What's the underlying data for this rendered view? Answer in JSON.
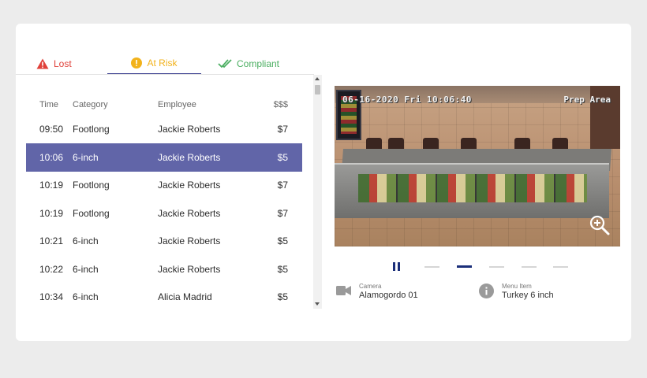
{
  "tabs": [
    {
      "label": "Lost",
      "icon": "warning-triangle-icon",
      "color": "#e0413a"
    },
    {
      "label": "At Risk",
      "icon": "exclamation-circle-icon",
      "color": "#f2b21b",
      "active": true
    },
    {
      "label": "Compliant",
      "icon": "double-check-icon",
      "color": "#4caf62"
    }
  ],
  "table": {
    "headers": {
      "time": "Time",
      "category": "Category",
      "employee": "Employee",
      "amount": "$$$"
    },
    "rows": [
      {
        "time": "09:50",
        "category": "Footlong",
        "employee": "Jackie Roberts",
        "amount": "$7"
      },
      {
        "time": "10:06",
        "category": "6-inch",
        "employee": "Jackie Roberts",
        "amount": "$5",
        "selected": true
      },
      {
        "time": "10:19",
        "category": "Footlong",
        "employee": "Jackie Roberts",
        "amount": "$7"
      },
      {
        "time": "10:19",
        "category": "Footlong",
        "employee": "Jackie Roberts",
        "amount": "$7"
      },
      {
        "time": "10:21",
        "category": "6-inch",
        "employee": "Jackie Roberts",
        "amount": "$5"
      },
      {
        "time": "10:22",
        "category": "6-inch",
        "employee": "Jackie Roberts",
        "amount": "$5"
      },
      {
        "time": "10:34",
        "category": "6-inch",
        "employee": "Alicia Madrid",
        "amount": "$5"
      }
    ]
  },
  "video": {
    "timestamp": "06-16-2020 Fri 10:06:40",
    "camera_label": "Prep Area",
    "zoom_icon": "zoom-in-icon"
  },
  "player": {
    "pause_icon": "pause-icon",
    "segments": 6,
    "active_segment": 2
  },
  "info": {
    "camera": {
      "caption": "Camera",
      "value": "Alamogordo 01",
      "icon": "video-camera-icon"
    },
    "menu_item": {
      "caption": "Menu Item",
      "value": "Turkey 6 inch",
      "icon": "info-icon"
    }
  },
  "colors": {
    "accent": "#1b2f7a",
    "selected_row": "#6165a8",
    "lost": "#e0413a",
    "at_risk": "#f2b21b",
    "compliant": "#4caf62"
  }
}
